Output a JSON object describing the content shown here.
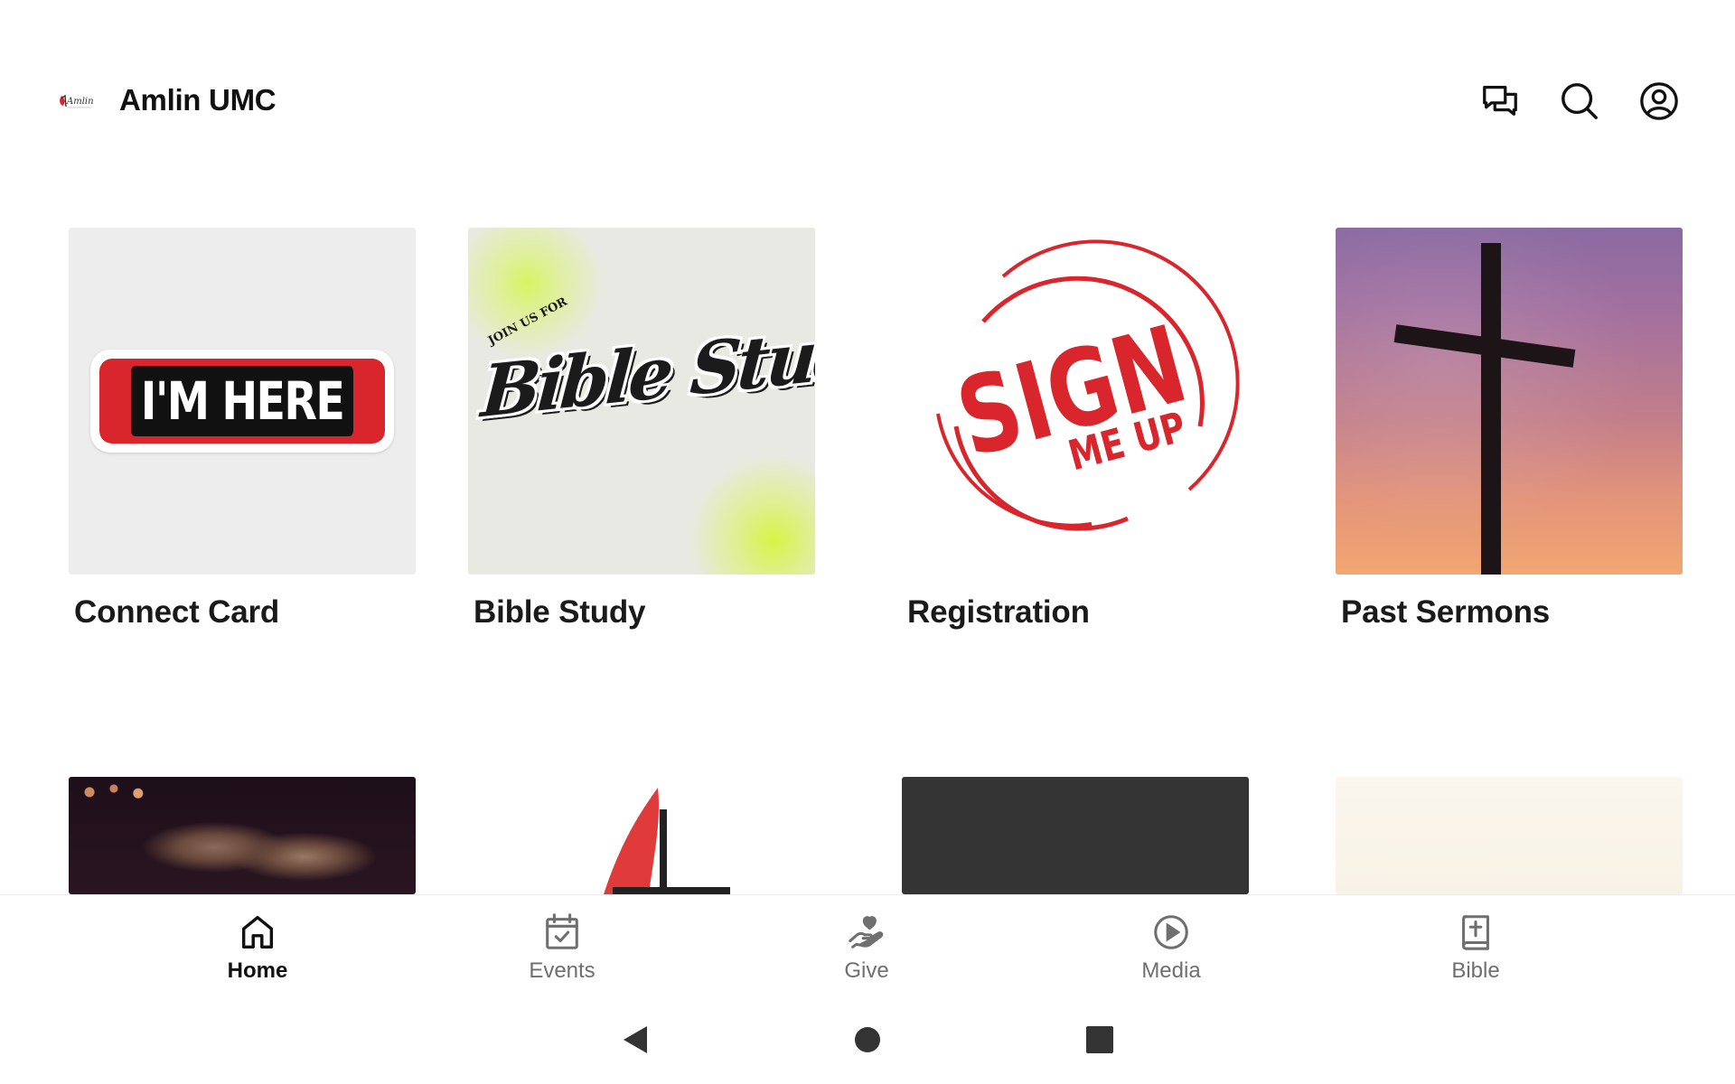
{
  "header": {
    "title": "Amlin UMC",
    "logo_text": "Amlin",
    "icons": [
      "chat-icon",
      "search-icon",
      "account-icon"
    ]
  },
  "tiles": [
    {
      "label": "Connect Card",
      "image_text": "I'M HERE"
    },
    {
      "label": "Bible Study",
      "image_text": "Bible Study",
      "image_small_text": "JOIN US FOR"
    },
    {
      "label": "Registration",
      "image_text": "SIGN",
      "image_text_2": "ME UP"
    },
    {
      "label": "Past Sermons"
    }
  ],
  "nav": {
    "items": [
      {
        "label": "Home",
        "icon": "home-icon",
        "active": true
      },
      {
        "label": "Events",
        "icon": "calendar-check-icon",
        "active": false
      },
      {
        "label": "Give",
        "icon": "give-hand-heart-icon",
        "active": false
      },
      {
        "label": "Media",
        "icon": "play-circle-icon",
        "active": false
      },
      {
        "label": "Bible",
        "icon": "bible-book-icon",
        "active": false
      }
    ]
  },
  "colors": {
    "accent_red": "#d8262c",
    "text_dark": "#111111",
    "nav_inactive": "#6f6f6f"
  }
}
